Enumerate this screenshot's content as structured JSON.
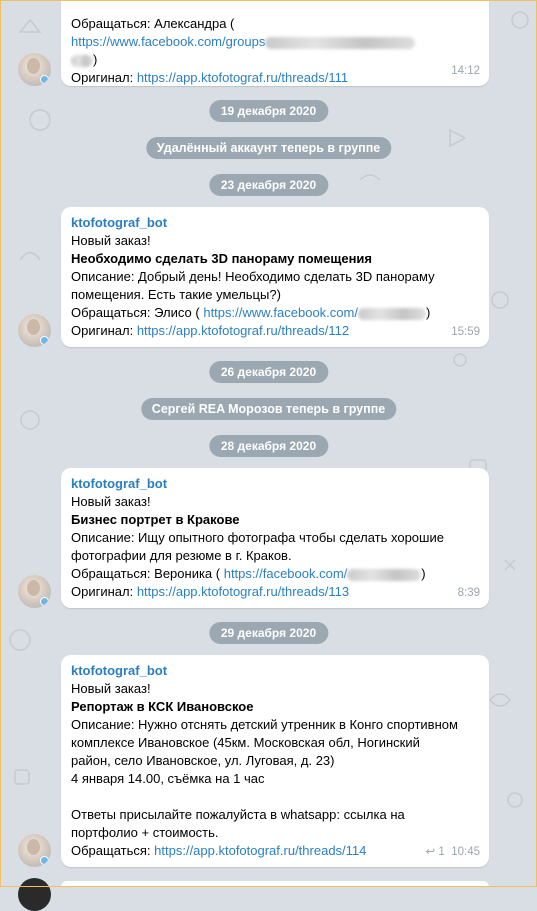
{
  "messages": [
    {
      "prefix_line": "Обращаться: Александра (",
      "fb_link": "https://www.facebook.com/groups",
      "fb_tail": ")",
      "original_label": "Оригинал: ",
      "original_link": "https://app.ktofotograf.ru/threads/111",
      "time": "14:12"
    },
    {
      "sender": "ktofotograf_bot",
      "new_order": "Новый заказ!",
      "title": "Необходимо сделать 3D панораму помещения",
      "description_1": "Описание: Добрый день! Необходимо сделать 3D панораму",
      "description_2": "помещения. Есть такие умельцы?)",
      "contact_label": "Обращаться: Элисо (  ",
      "contact_link": "https://www.facebook.com/",
      "contact_tail": ")",
      "original_label": "Оригинал: ",
      "original_link": "https://app.ktofotograf.ru/threads/112",
      "time": "15:59"
    },
    {
      "sender": "ktofotograf_bot",
      "new_order": "Новый заказ!",
      "title": "Бизнес портрет в Кракове",
      "description_1": "Описание: Ищу опытного фотографа чтобы сделать хорошие",
      "description_2": "фотографии для резюме в г. Краков.",
      "contact_label": "Обращаться: Вероника (  ",
      "contact_link": "https://facebook.com/",
      "contact_tail": ")",
      "original_label": "Оригинал: ",
      "original_link": "https://app.ktofotograf.ru/threads/113",
      "time": "8:39"
    },
    {
      "sender": "ktofotograf_bot",
      "new_order": "Новый заказ!",
      "title": "Репортаж в КСК Ивановское",
      "description_1": "Описание: Нужно отснять детский утренник в Конго спортивном",
      "description_2": "комплексе Ивановское (45км. Московская обл, Ногинский",
      "description_3": "район, село Ивановское, ул. Луговая, д. 23)",
      "description_4": "4 января 14.00, съёмка на 1 час",
      "reply_1": "Ответы присылайте пожалуйста в whatsapp: ссылка на",
      "reply_2": "портфолио + стоимость.",
      "contact_label": "Обращаться: ",
      "contact_link": "https://app.ktofotograf.ru/threads/114",
      "reply_icon": "↩",
      "reply_count": "1",
      "time": "10:45"
    }
  ],
  "dates": {
    "d1": "19 декабря 2020",
    "d2": "23 декабря 2020",
    "d3": "26 декабря 2020",
    "d4": "28 декабря 2020",
    "d5": "29 декабря 2020"
  },
  "service": {
    "s1": "Удалённый аккаунт теперь в группе",
    "s2": "Сергей REA Морозов теперь в группе"
  }
}
